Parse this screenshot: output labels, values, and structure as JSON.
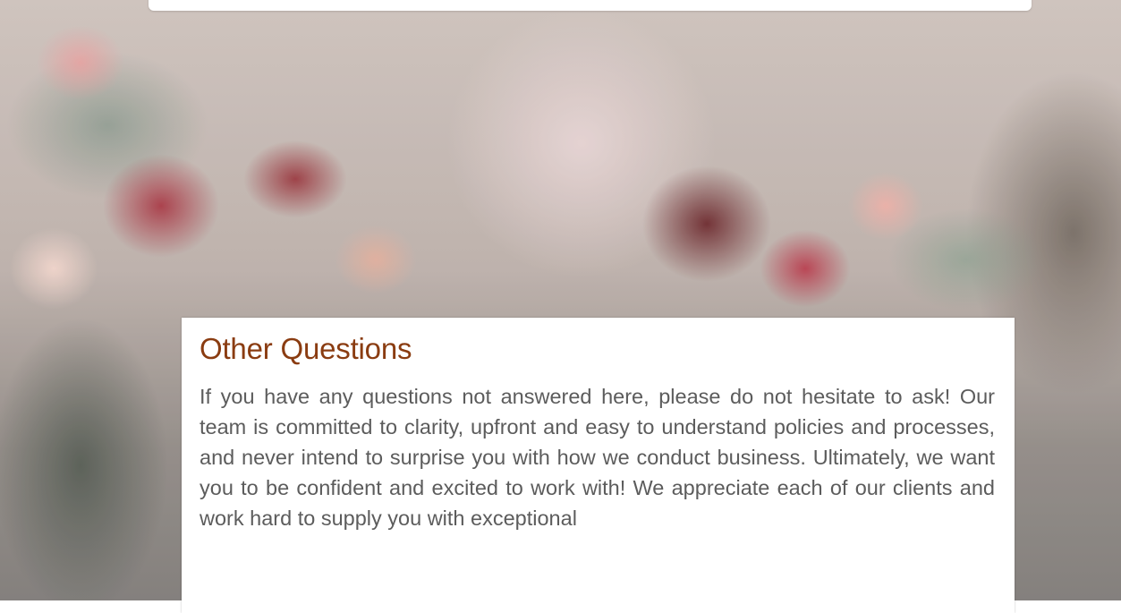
{
  "section": {
    "heading": "Other Questions",
    "body": "If you have any questions not answered here, please do not hesitate to ask! Our team is committed to clarity, upfront and easy to understand policies and processes, and never intend to surprise you with how we conduct business. Ultimately, we want you to be confident and excited to work with! We appreciate each of our clients and work hard to supply you with exceptional"
  },
  "colors": {
    "heading": "#8a3c11",
    "body_text": "#5c5c5c",
    "card_bg": "#ffffff"
  }
}
